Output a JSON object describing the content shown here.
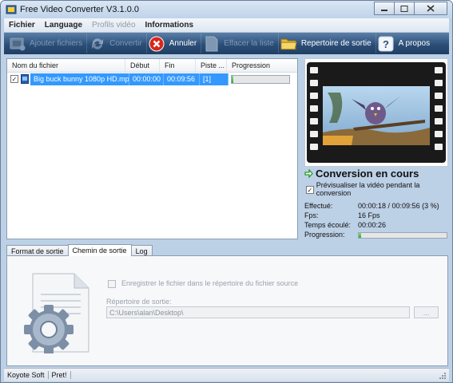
{
  "window": {
    "title": "Free Video Converter V3.1.0.0"
  },
  "menu": [
    "Fichier",
    "Language",
    "Profils vidéo",
    "Informations"
  ],
  "toolbar": {
    "add": "Ajouter fichiers",
    "convert": "Convertir",
    "cancel": "Annuler",
    "remove": "Effacer la liste",
    "output_dir": "Repertoire de sortie",
    "about": "A propos"
  },
  "filelist": {
    "columns": [
      "Nom du fichier",
      "Début",
      "Fin",
      "Piste ...",
      "Progression"
    ],
    "rows": [
      {
        "checked": true,
        "name": "Big buck bunny 1080p HD.mp4",
        "start": "00:00:00",
        "end": "00:09:56",
        "track": "[1]",
        "progress": 0.03
      }
    ]
  },
  "preview": {
    "status": "Conversion en cours",
    "preview_checkbox": "Prévisualiser la vidéo pendant la conversion",
    "preview_checked": true
  },
  "stats": {
    "done_label": "Effectué:",
    "done_value": "00:00:18 / 00:09:56  (3 %)",
    "fps_label": "Fps:",
    "fps_value": "16 Fps",
    "elapsed_label": "Temps écoulé:",
    "elapsed_value": "00:00:26",
    "progress_label": "Progression:",
    "progress": 0.03
  },
  "tabs": [
    "Format de sortie",
    "Chemin de sortie",
    "Log"
  ],
  "output_path": {
    "same_dir_label": "Enregistrer le fichier dans le répertoire du fichier source",
    "dir_label": "Répertoire de sortie:",
    "dir_value": "C:\\Users\\alan\\Desktop\\",
    "browse": "..."
  },
  "status": [
    "Koyote Soft",
    "Pret!"
  ],
  "colors": {
    "toolbar": "#2c4f78",
    "selection": "#3399ff",
    "progress": "#2aab2a"
  }
}
